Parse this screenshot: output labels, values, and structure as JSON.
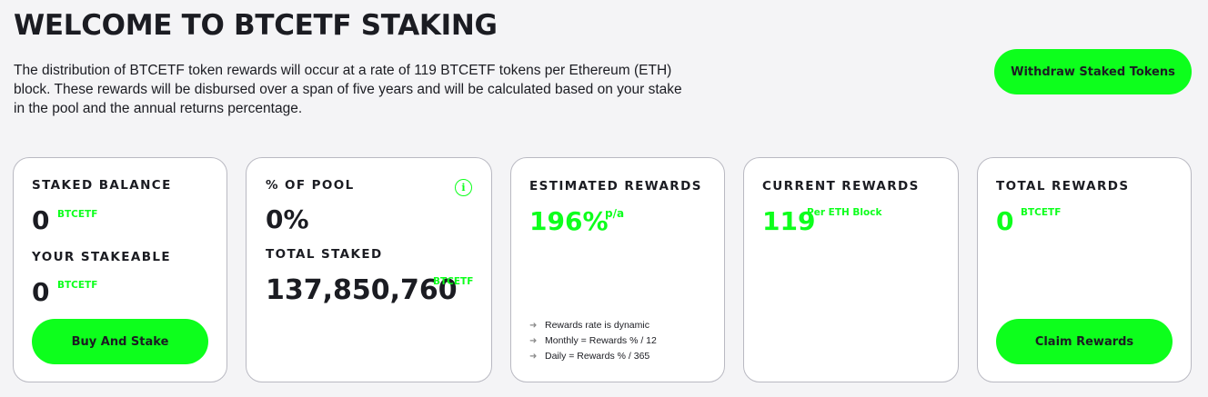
{
  "header": {
    "title": "WELCOME TO BTCETF STAKING",
    "description": "The distribution of BTCETF token rewards will occur at a rate of 119 BTCETF tokens per Ethereum (ETH) block. These rewards will be disbursed over a span of five years and will be calculated based on your stake in the pool and the annual returns percentage.",
    "withdraw_label": "Withdraw Staked Tokens"
  },
  "cards": {
    "staked": {
      "label": "STAKED BALANCE",
      "value": "0",
      "unit": "BTCETF",
      "stakeable_label": "YOUR STAKEABLE",
      "stakeable_value": "0",
      "stakeable_unit": "BTCETF",
      "button_label": "Buy And Stake"
    },
    "pool": {
      "label": "% OF POOL",
      "value": "0%",
      "total_label": "TOTAL STAKED",
      "total_value": "137,850,760",
      "total_unit": "BTCETF",
      "info_icon": "i"
    },
    "estimated": {
      "label": "ESTIMATED REWARDS",
      "value": "196%",
      "unit": "p/a",
      "notes": [
        "Rewards rate is dynamic",
        "Monthly = Rewards % / 12",
        "Daily = Rewards % / 365"
      ]
    },
    "current": {
      "label": "CURRENT REWARDS",
      "value": "119",
      "unit": "Per ETH Block"
    },
    "total": {
      "label": "TOTAL REWARDS",
      "value": "0",
      "unit": "BTCETF",
      "button_label": "Claim Rewards"
    }
  },
  "colors": {
    "accent": "#0dff1c",
    "background": "#f4f4f6",
    "text": "#1b1c22"
  }
}
